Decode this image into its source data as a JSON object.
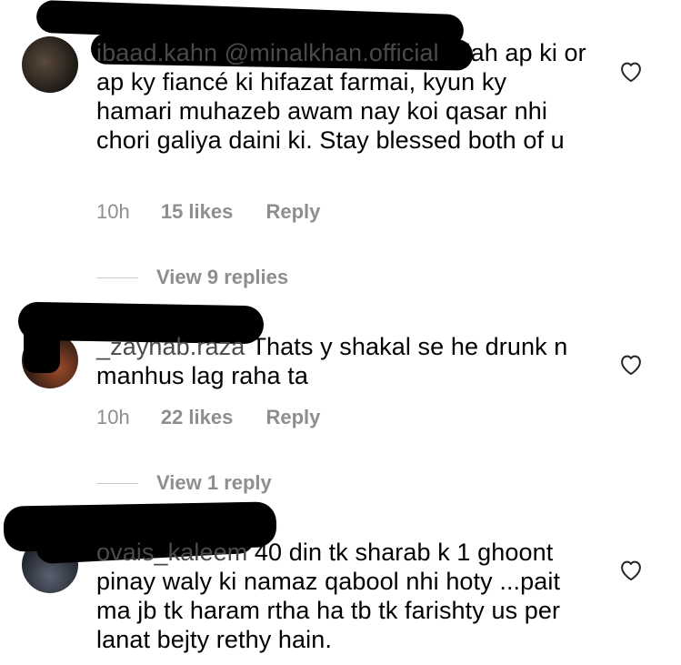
{
  "comments": [
    {
      "username": "ibaad.kahn",
      "mention": "@minalkhan.official",
      "text": "allah ap ki or ap ky fiancé ki hifazat farmai, kyun ky hamari muhazeb awam nay koi qasar nhi chori galiya daini ki. Stay blessed both of u",
      "time": "10h",
      "likes": "15 likes",
      "reply": "Reply",
      "view_replies": "View 9 replies",
      "avatar_color": "#2b2620"
    },
    {
      "username": "_zaynab.raza",
      "mention": "",
      "text": "Thats y shakal se he drunk n manhus lag raha ta",
      "time": "10h",
      "likes": "22 likes",
      "reply": "Reply",
      "view_replies": "View 1 reply",
      "avatar_color": "#3a2418"
    },
    {
      "username": "ovais_kaleem",
      "mention": "",
      "text": "40 din tk sharab k 1 ghoont pinay waly ki namaz qabool nhi hoty ...pait ma jb tk haram rtha ha tb tk farishty us per lanat bejty rethy hain.",
      "avatar_color": "#2e3340"
    }
  ],
  "icons": {
    "like": "heart-outline-icon"
  },
  "colors": {
    "secondary_text": "#8e8e8e",
    "divider": "#c7c7c7",
    "redaction": "#000000"
  }
}
